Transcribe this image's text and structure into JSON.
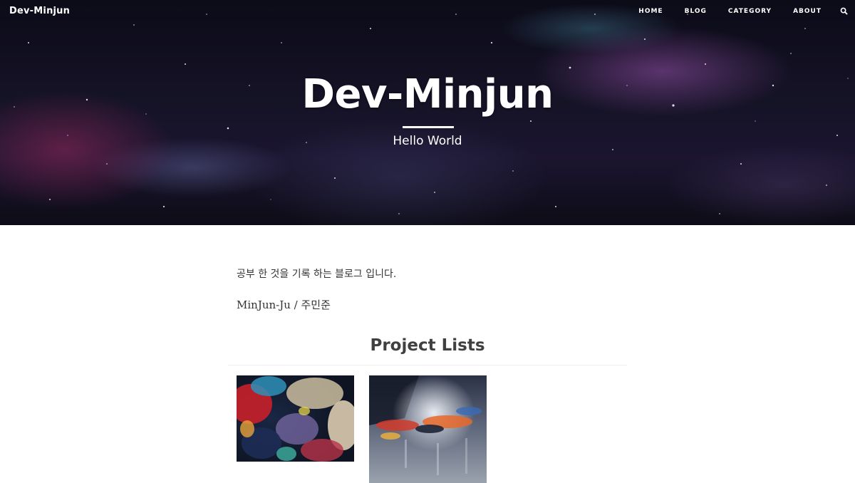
{
  "header": {
    "brand": "Dev-Minjun",
    "nav": [
      "HOME",
      "BLOG",
      "CATEGORY",
      "ABOUT"
    ],
    "search_icon": "search-icon"
  },
  "hero": {
    "title": "Dev-Minjun",
    "subtitle": "Hello World"
  },
  "main": {
    "intro": "공부 한 것을 기록 하는 블로그 입니다.",
    "author": "MinJun-Ju / 주민준",
    "projects_title": "Project Lists",
    "projects": [
      {
        "thumbnail": "abstract-painting-colorful"
      },
      {
        "thumbnail": "abstract-painting-explosion"
      }
    ]
  },
  "colors": {
    "hero_bg": "#151326",
    "text": "#333333",
    "heading": "#404040",
    "divider": "#eeeeee"
  }
}
